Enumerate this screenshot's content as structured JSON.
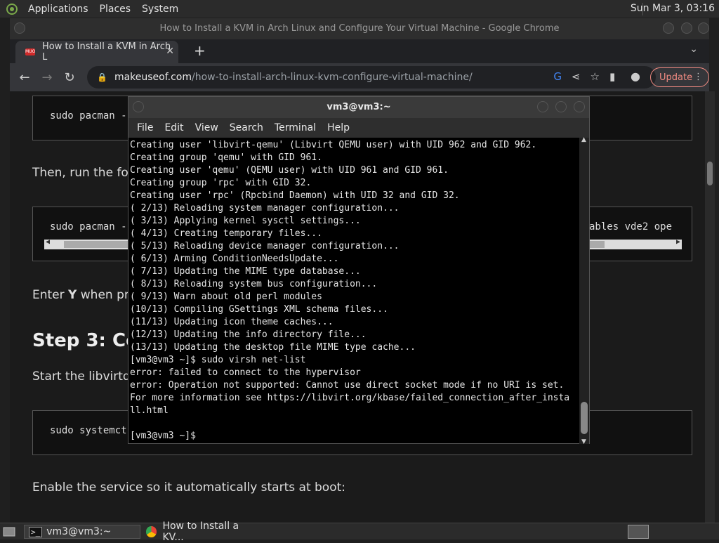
{
  "top_panel": {
    "menus": [
      "Applications",
      "Places",
      "System"
    ],
    "clock": "Sun Mar 3, 03:16"
  },
  "chrome": {
    "window_title": "How to Install a KVM in Arch Linux and Configure Your Virtual Machine - Google Chrome",
    "tab_title": "How to Install a KVM in Arch L",
    "url_host": "makeuseof.com",
    "url_path": "/how-to-install-arch-linux-kvm-configure-virtual-machine/",
    "update_label": "Update"
  },
  "page": {
    "code1": "sudo pacman -",
    "para1": "Then, run the fol",
    "code2_left": "sudo pacman -",
    "code2_right": "ables vde2 ope",
    "para2_prefix": "Enter ",
    "para2_bold": "Y",
    "para2_suffix": " when pro",
    "heading": "Step 3: Co",
    "para3": "Start the libvirtd",
    "code3": "sudo systemct",
    "para4": "Enable the service so it automatically starts at boot:"
  },
  "terminal": {
    "title": "vm3@vm3:~",
    "menu": [
      "File",
      "Edit",
      "View",
      "Search",
      "Terminal",
      "Help"
    ],
    "lines": [
      "Creating user 'libvirt-qemu' (Libvirt QEMU user) with UID 962 and GID 962.",
      "Creating group 'qemu' with GID 961.",
      "Creating user 'qemu' (QEMU user) with UID 961 and GID 961.",
      "Creating group 'rpc' with GID 32.",
      "Creating user 'rpc' (Rpcbind Daemon) with UID 32 and GID 32.",
      "( 2/13) Reloading system manager configuration...",
      "( 3/13) Applying kernel sysctl settings...",
      "( 4/13) Creating temporary files...",
      "( 5/13) Reloading device manager configuration...",
      "( 6/13) Arming ConditionNeedsUpdate...",
      "( 7/13) Updating the MIME type database...",
      "( 8/13) Reloading system bus configuration...",
      "( 9/13) Warn about old perl modules",
      "(10/13) Compiling GSettings XML schema files...",
      "(11/13) Updating icon theme caches...",
      "(12/13) Updating the info directory file...",
      "(13/13) Updating the desktop file MIME type cache...",
      "[vm3@vm3 ~]$ sudo virsh net-list",
      "error: failed to connect to the hypervisor",
      "error: Operation not supported: Cannot use direct socket mode if no URI is set.",
      "For more information see https://libvirt.org/kbase/failed_connection_after_insta",
      "ll.html",
      "",
      "[vm3@vm3 ~]$"
    ]
  },
  "taskbar": {
    "task1": "vm3@vm3:~",
    "task2": "How to Install a KV..."
  }
}
